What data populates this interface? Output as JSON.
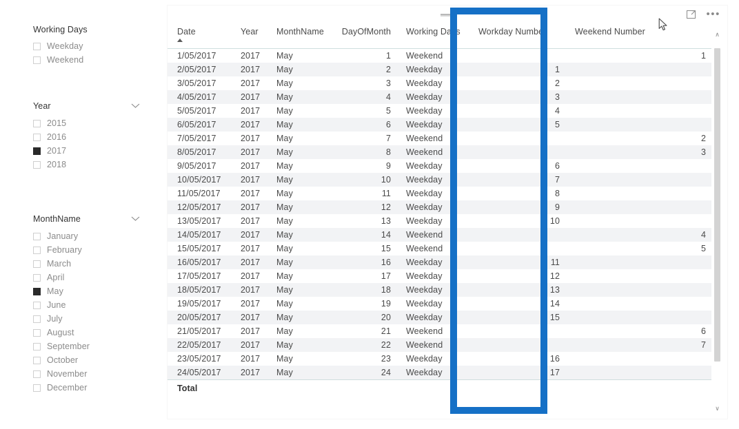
{
  "slicers": [
    {
      "id": "working-days",
      "title": "Working Days",
      "has_chevron": false,
      "chevron_icon": "chevron-down-icon",
      "items": [
        {
          "label": "Weekday",
          "checked": false
        },
        {
          "label": "Weekend",
          "checked": false
        }
      ]
    },
    {
      "id": "year",
      "title": "Year",
      "has_chevron": true,
      "chevron_icon": "chevron-down-icon",
      "items": [
        {
          "label": "2015",
          "checked": false
        },
        {
          "label": "2016",
          "checked": false
        },
        {
          "label": "2017",
          "checked": true
        },
        {
          "label": "2018",
          "checked": false
        }
      ]
    },
    {
      "id": "month",
      "title": "MonthName",
      "has_chevron": true,
      "chevron_icon": "chevron-down-icon",
      "items": [
        {
          "label": "January",
          "checked": false
        },
        {
          "label": "February",
          "checked": false
        },
        {
          "label": "March",
          "checked": false
        },
        {
          "label": "April",
          "checked": false
        },
        {
          "label": "May",
          "checked": true
        },
        {
          "label": "June",
          "checked": false
        },
        {
          "label": "July",
          "checked": false
        },
        {
          "label": "August",
          "checked": false
        },
        {
          "label": "September",
          "checked": false
        },
        {
          "label": "October",
          "checked": false
        },
        {
          "label": "November",
          "checked": false
        },
        {
          "label": "December",
          "checked": false
        }
      ]
    }
  ],
  "visual": {
    "drag_handle_icon": "drag-handle-icon",
    "focus_mode_icon": "focus-mode-icon",
    "more_options_icon": "more-options-ellipsis-icon",
    "more_options_label": "•••",
    "scrollbar": {
      "up_icon": "chevron-up-icon",
      "down_icon": "chevron-down-icon",
      "up_glyph": "∧",
      "down_glyph": "∨"
    },
    "highlight": {
      "color": "#1570c6",
      "target_column": "Workday Number"
    }
  },
  "table": {
    "columns": [
      {
        "key": "date",
        "label": "Date",
        "align": "left",
        "sorted": "asc"
      },
      {
        "key": "year",
        "label": "Year",
        "align": "left",
        "sorted": ""
      },
      {
        "key": "month",
        "label": "MonthName",
        "align": "left",
        "sorted": ""
      },
      {
        "key": "day_of_month",
        "label": "DayOfMonth",
        "align": "right",
        "sorted": ""
      },
      {
        "key": "working_days",
        "label": "Working Days",
        "align": "left",
        "sorted": ""
      },
      {
        "key": "workday_number",
        "label": "Workday Number",
        "align": "right",
        "sorted": ""
      },
      {
        "key": "weekend_number",
        "label": "Weekend Number",
        "align": "right",
        "sorted": ""
      }
    ],
    "rows": [
      {
        "date": "1/05/2017",
        "year": "2017",
        "month": "May",
        "day_of_month": "1",
        "working_days": "Weekend",
        "workday_number": "",
        "weekend_number": "1"
      },
      {
        "date": "2/05/2017",
        "year": "2017",
        "month": "May",
        "day_of_month": "2",
        "working_days": "Weekday",
        "workday_number": "1",
        "weekend_number": ""
      },
      {
        "date": "3/05/2017",
        "year": "2017",
        "month": "May",
        "day_of_month": "3",
        "working_days": "Weekday",
        "workday_number": "2",
        "weekend_number": ""
      },
      {
        "date": "4/05/2017",
        "year": "2017",
        "month": "May",
        "day_of_month": "4",
        "working_days": "Weekday",
        "workday_number": "3",
        "weekend_number": ""
      },
      {
        "date": "5/05/2017",
        "year": "2017",
        "month": "May",
        "day_of_month": "5",
        "working_days": "Weekday",
        "workday_number": "4",
        "weekend_number": ""
      },
      {
        "date": "6/05/2017",
        "year": "2017",
        "month": "May",
        "day_of_month": "6",
        "working_days": "Weekday",
        "workday_number": "5",
        "weekend_number": ""
      },
      {
        "date": "7/05/2017",
        "year": "2017",
        "month": "May",
        "day_of_month": "7",
        "working_days": "Weekend",
        "workday_number": "",
        "weekend_number": "2"
      },
      {
        "date": "8/05/2017",
        "year": "2017",
        "month": "May",
        "day_of_month": "8",
        "working_days": "Weekend",
        "workday_number": "",
        "weekend_number": "3"
      },
      {
        "date": "9/05/2017",
        "year": "2017",
        "month": "May",
        "day_of_month": "9",
        "working_days": "Weekday",
        "workday_number": "6",
        "weekend_number": ""
      },
      {
        "date": "10/05/2017",
        "year": "2017",
        "month": "May",
        "day_of_month": "10",
        "working_days": "Weekday",
        "workday_number": "7",
        "weekend_number": ""
      },
      {
        "date": "11/05/2017",
        "year": "2017",
        "month": "May",
        "day_of_month": "11",
        "working_days": "Weekday",
        "workday_number": "8",
        "weekend_number": ""
      },
      {
        "date": "12/05/2017",
        "year": "2017",
        "month": "May",
        "day_of_month": "12",
        "working_days": "Weekday",
        "workday_number": "9",
        "weekend_number": ""
      },
      {
        "date": "13/05/2017",
        "year": "2017",
        "month": "May",
        "day_of_month": "13",
        "working_days": "Weekday",
        "workday_number": "10",
        "weekend_number": ""
      },
      {
        "date": "14/05/2017",
        "year": "2017",
        "month": "May",
        "day_of_month": "14",
        "working_days": "Weekend",
        "workday_number": "",
        "weekend_number": "4"
      },
      {
        "date": "15/05/2017",
        "year": "2017",
        "month": "May",
        "day_of_month": "15",
        "working_days": "Weekend",
        "workday_number": "",
        "weekend_number": "5"
      },
      {
        "date": "16/05/2017",
        "year": "2017",
        "month": "May",
        "day_of_month": "16",
        "working_days": "Weekday",
        "workday_number": "11",
        "weekend_number": ""
      },
      {
        "date": "17/05/2017",
        "year": "2017",
        "month": "May",
        "day_of_month": "17",
        "working_days": "Weekday",
        "workday_number": "12",
        "weekend_number": ""
      },
      {
        "date": "18/05/2017",
        "year": "2017",
        "month": "May",
        "day_of_month": "18",
        "working_days": "Weekday",
        "workday_number": "13",
        "weekend_number": ""
      },
      {
        "date": "19/05/2017",
        "year": "2017",
        "month": "May",
        "day_of_month": "19",
        "working_days": "Weekday",
        "workday_number": "14",
        "weekend_number": ""
      },
      {
        "date": "20/05/2017",
        "year": "2017",
        "month": "May",
        "day_of_month": "20",
        "working_days": "Weekday",
        "workday_number": "15",
        "weekend_number": ""
      },
      {
        "date": "21/05/2017",
        "year": "2017",
        "month": "May",
        "day_of_month": "21",
        "working_days": "Weekend",
        "workday_number": "",
        "weekend_number": "6"
      },
      {
        "date": "22/05/2017",
        "year": "2017",
        "month": "May",
        "day_of_month": "22",
        "working_days": "Weekend",
        "workday_number": "",
        "weekend_number": "7"
      },
      {
        "date": "23/05/2017",
        "year": "2017",
        "month": "May",
        "day_of_month": "23",
        "working_days": "Weekday",
        "workday_number": "16",
        "weekend_number": ""
      },
      {
        "date": "24/05/2017",
        "year": "2017",
        "month": "May",
        "day_of_month": "24",
        "working_days": "Weekday",
        "workday_number": "17",
        "weekend_number": ""
      }
    ],
    "total_row": {
      "date": "Total",
      "year": "",
      "month": "",
      "day_of_month": "",
      "working_days": "",
      "workday_number": "",
      "weekend_number": ""
    }
  }
}
